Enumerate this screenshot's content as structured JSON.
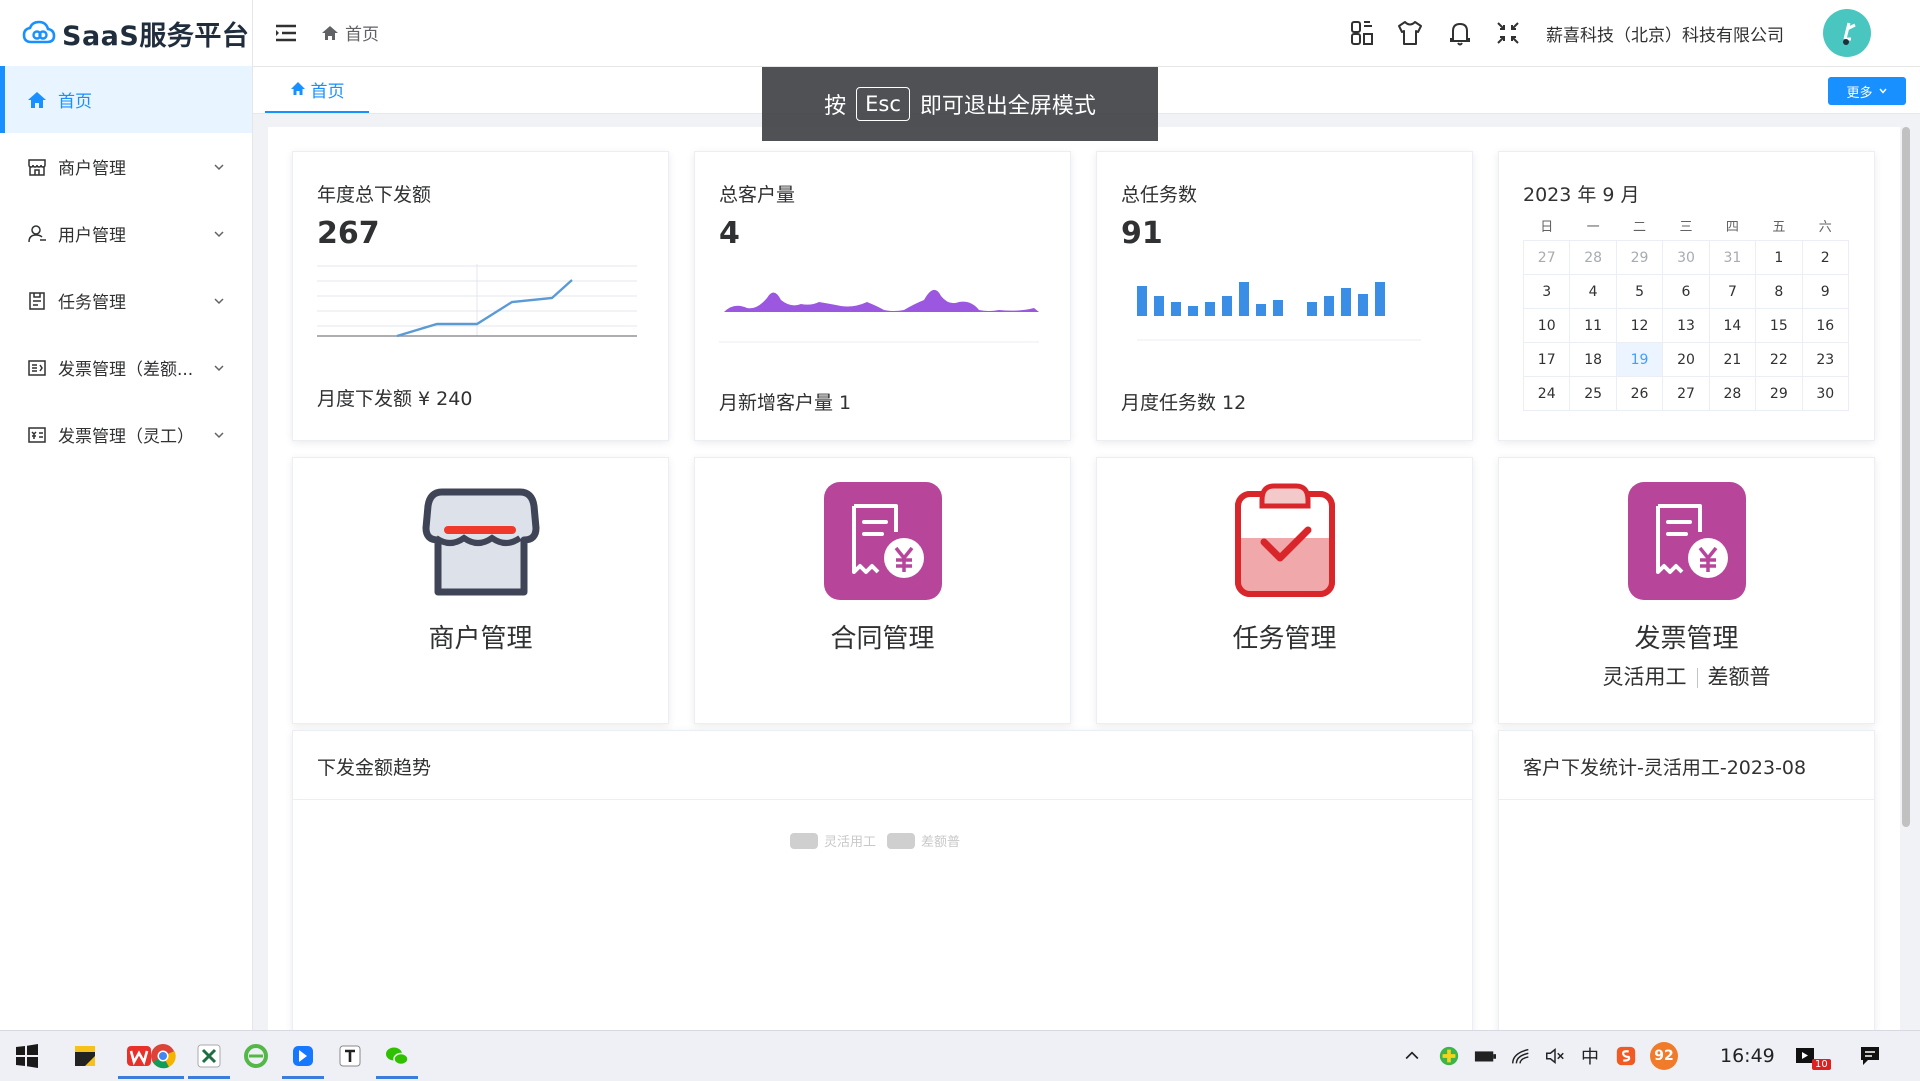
{
  "app": {
    "logo_text": "SaaS服务平台"
  },
  "sidebar": {
    "items": [
      {
        "label": "首页",
        "icon": "home-icon",
        "active": true
      },
      {
        "label": "商户管理",
        "icon": "shop-icon"
      },
      {
        "label": "用户管理",
        "icon": "user-icon"
      },
      {
        "label": "任务管理",
        "icon": "task-icon"
      },
      {
        "label": "发票管理（差额...",
        "icon": "invoice-icon"
      },
      {
        "label": "发票管理（灵工）",
        "icon": "invoice-icon"
      }
    ]
  },
  "header": {
    "breadcrumb": "首页",
    "company": "薪喜科技（北京）科技有限公司",
    "icons": [
      "layout-icon",
      "theme-shirt-icon",
      "bell-icon",
      "exit-fullscreen-icon"
    ]
  },
  "tags": {
    "home": "首页",
    "more": "更多"
  },
  "toast": {
    "prefix": "按",
    "key": "Esc",
    "suffix": "即可退出全屏模式"
  },
  "stats": [
    {
      "title": "年度总下发额",
      "value": "267",
      "foot": "月度下发额 ¥ 240",
      "chart": "line"
    },
    {
      "title": "总客户量",
      "value": "4",
      "foot": "月新增客户量 1",
      "chart": "area"
    },
    {
      "title": "总任务数",
      "value": "91",
      "foot": "月度任务数 12",
      "chart": "bar"
    }
  ],
  "calendar": {
    "title": "2023 年 9 月",
    "weekdays": [
      "日",
      "一",
      "二",
      "三",
      "四",
      "五",
      "六"
    ],
    "weeks": [
      [
        "27",
        "28",
        "29",
        "30",
        "31",
        "1",
        "2"
      ],
      [
        "3",
        "4",
        "5",
        "6",
        "7",
        "8",
        "9"
      ],
      [
        "10",
        "11",
        "12",
        "13",
        "14",
        "15",
        "16"
      ],
      [
        "17",
        "18",
        "19",
        "20",
        "21",
        "22",
        "23"
      ],
      [
        "24",
        "25",
        "26",
        "27",
        "28",
        "29",
        "30"
      ]
    ],
    "today": "19"
  },
  "entries": [
    {
      "label": "商户管理",
      "icon": "shop-awning-icon"
    },
    {
      "label": "合同管理",
      "icon": "contract-yen-icon"
    },
    {
      "label": "任务管理",
      "icon": "clipboard-check-icon"
    },
    {
      "label": "发票管理",
      "icon": "invoice-yen-icon",
      "sub": [
        "灵活用工",
        "差额普"
      ]
    }
  ],
  "panels": {
    "trend": {
      "title": "下发金额趋势",
      "legend": [
        "灵活用工",
        "差额普"
      ]
    },
    "customer": {
      "title": "客户下发统计-灵活用工-2023-08"
    }
  },
  "taskbar": {
    "apps": [
      "windows-start-icon",
      "sticky-notes-icon",
      "wps-icon",
      "chrome-icon",
      "excel-icon",
      "ie-icon",
      "app-blue-icon",
      "typora-icon",
      "wechat-icon"
    ],
    "tray_badge": "92",
    "ime": "中",
    "time": "16:49",
    "notif_count": "10"
  },
  "colors": {
    "accent": "#1890ff",
    "purple": "#9b57e0",
    "magenta": "#b7469b",
    "red": "#d9262b"
  }
}
